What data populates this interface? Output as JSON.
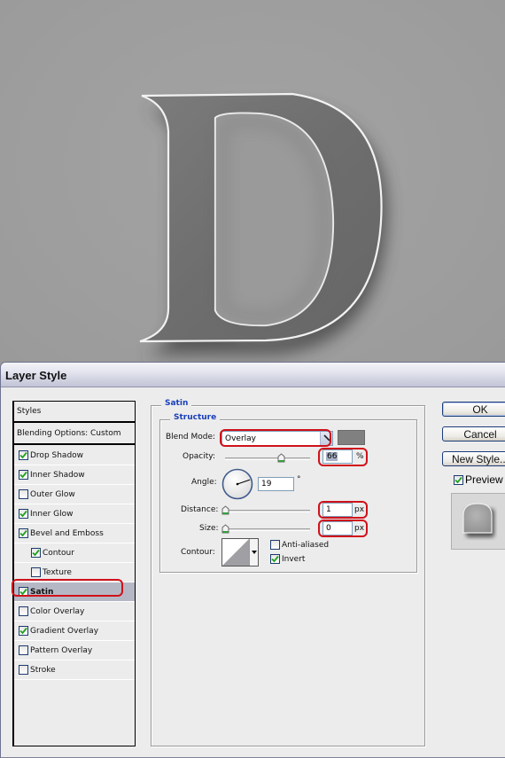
{
  "dialog": {
    "title": "Layer Style"
  },
  "styles_list": {
    "header": "Styles",
    "blending_options": "Blending Options: Custom",
    "items": [
      {
        "label": "Drop Shadow",
        "checked": true,
        "indent": 0,
        "selected": false
      },
      {
        "label": "Inner Shadow",
        "checked": true,
        "indent": 0,
        "selected": false
      },
      {
        "label": "Outer Glow",
        "checked": false,
        "indent": 0,
        "selected": false
      },
      {
        "label": "Inner Glow",
        "checked": true,
        "indent": 0,
        "selected": false
      },
      {
        "label": "Bevel and Emboss",
        "checked": true,
        "indent": 0,
        "selected": false
      },
      {
        "label": "Contour",
        "checked": true,
        "indent": 1,
        "selected": false
      },
      {
        "label": "Texture",
        "checked": false,
        "indent": 1,
        "selected": false
      },
      {
        "label": "Satin",
        "checked": true,
        "indent": 0,
        "selected": true
      },
      {
        "label": "Color Overlay",
        "checked": false,
        "indent": 0,
        "selected": false
      },
      {
        "label": "Gradient Overlay",
        "checked": true,
        "indent": 0,
        "selected": false
      },
      {
        "label": "Pattern Overlay",
        "checked": false,
        "indent": 0,
        "selected": false
      },
      {
        "label": "Stroke",
        "checked": false,
        "indent": 0,
        "selected": false
      }
    ]
  },
  "satin": {
    "section_title": "Satin",
    "structure_title": "Structure",
    "blend_mode_label": "Blend Mode:",
    "blend_mode_value": "Overlay",
    "swatch_color": "#808080",
    "opacity_label": "Opacity:",
    "opacity_value": "66",
    "opacity_unit": "%",
    "opacity_fraction": 0.66,
    "angle_label": "Angle:",
    "angle_value": "19",
    "angle_unit": "°",
    "distance_label": "Distance:",
    "distance_value": "1",
    "distance_unit": "px",
    "size_label": "Size:",
    "size_value": "0",
    "size_unit": "px",
    "contour_label": "Contour:",
    "anti_aliased_label": "Anti-aliased",
    "anti_aliased_checked": false,
    "invert_label": "Invert",
    "invert_checked": true
  },
  "buttons": {
    "ok": "OK",
    "cancel": "Cancel",
    "new_style": "New Style...",
    "preview_label": "Preview",
    "preview_checked": true
  },
  "canvas": {
    "letter": "D"
  },
  "colors": {
    "highlight": "#d0111a",
    "group_title": "#1a3fb8",
    "selected_row": "#b5b8c4",
    "check": "#21a121"
  }
}
